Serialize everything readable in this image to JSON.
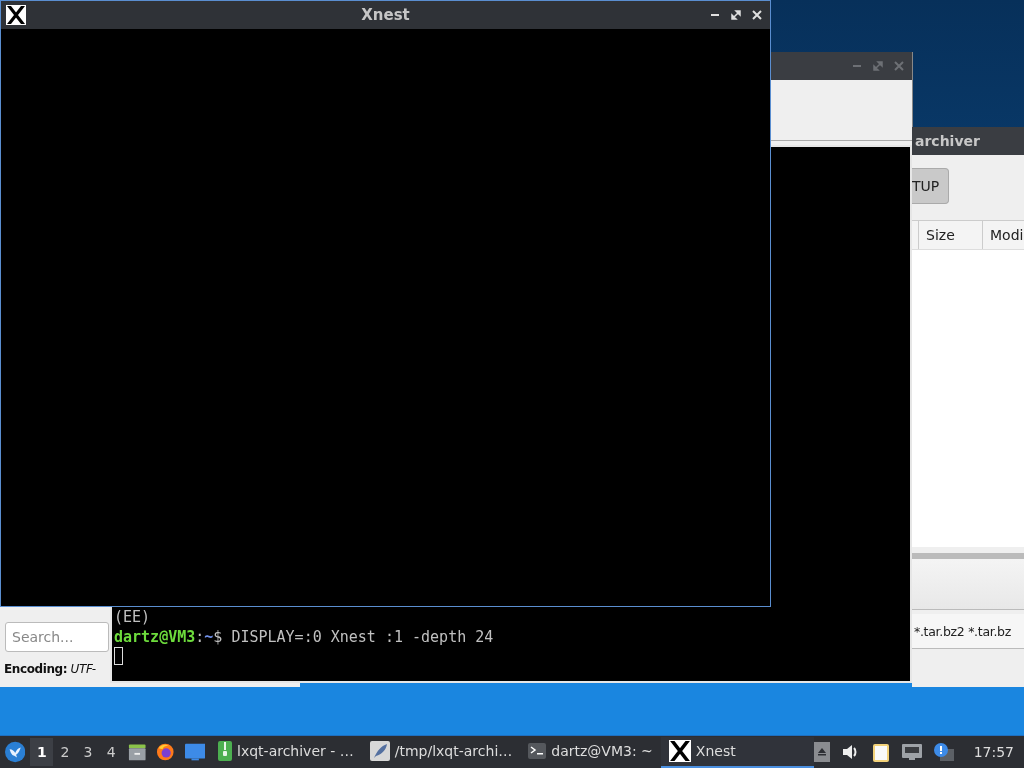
{
  "xnest": {
    "title": "Xnest"
  },
  "archiver": {
    "title": "archiver",
    "toolbar_button": "TUP",
    "columns": [
      "Size",
      "Modi"
    ],
    "filter": "*.tar.bz2 *.tar.bz"
  },
  "dialog": {
    "search": {
      "placeholder": "Search..."
    },
    "encoding": "**Encoding:** *UTF-*"
  },
  "terminal": {
    "output": "(EE)",
    "user": "dartz@VM3",
    "separator": ":",
    "path": "~",
    "symbol": "$",
    "command": " DISPLAY=:0 Xnest :1 -depth 24"
  },
  "taskbar": {
    "workspaces": [
      {
        "label": "1",
        "selected": true
      },
      {
        "label": "2",
        "selected": false
      },
      {
        "label": "3",
        "selected": false
      },
      {
        "label": "4",
        "selected": false
      }
    ],
    "tasks": [
      {
        "kind": "archive",
        "label": "lxqt-archiver - …",
        "selected": false
      },
      {
        "kind": "editor",
        "label": "/tmp/lxqt-archi…",
        "selected": false
      },
      {
        "kind": "terminal",
        "label": "dartz@VM3: ~",
        "selected": false
      },
      {
        "kind": "xlogo",
        "label": "Xnest",
        "selected": true
      }
    ],
    "clock": "17:57"
  }
}
